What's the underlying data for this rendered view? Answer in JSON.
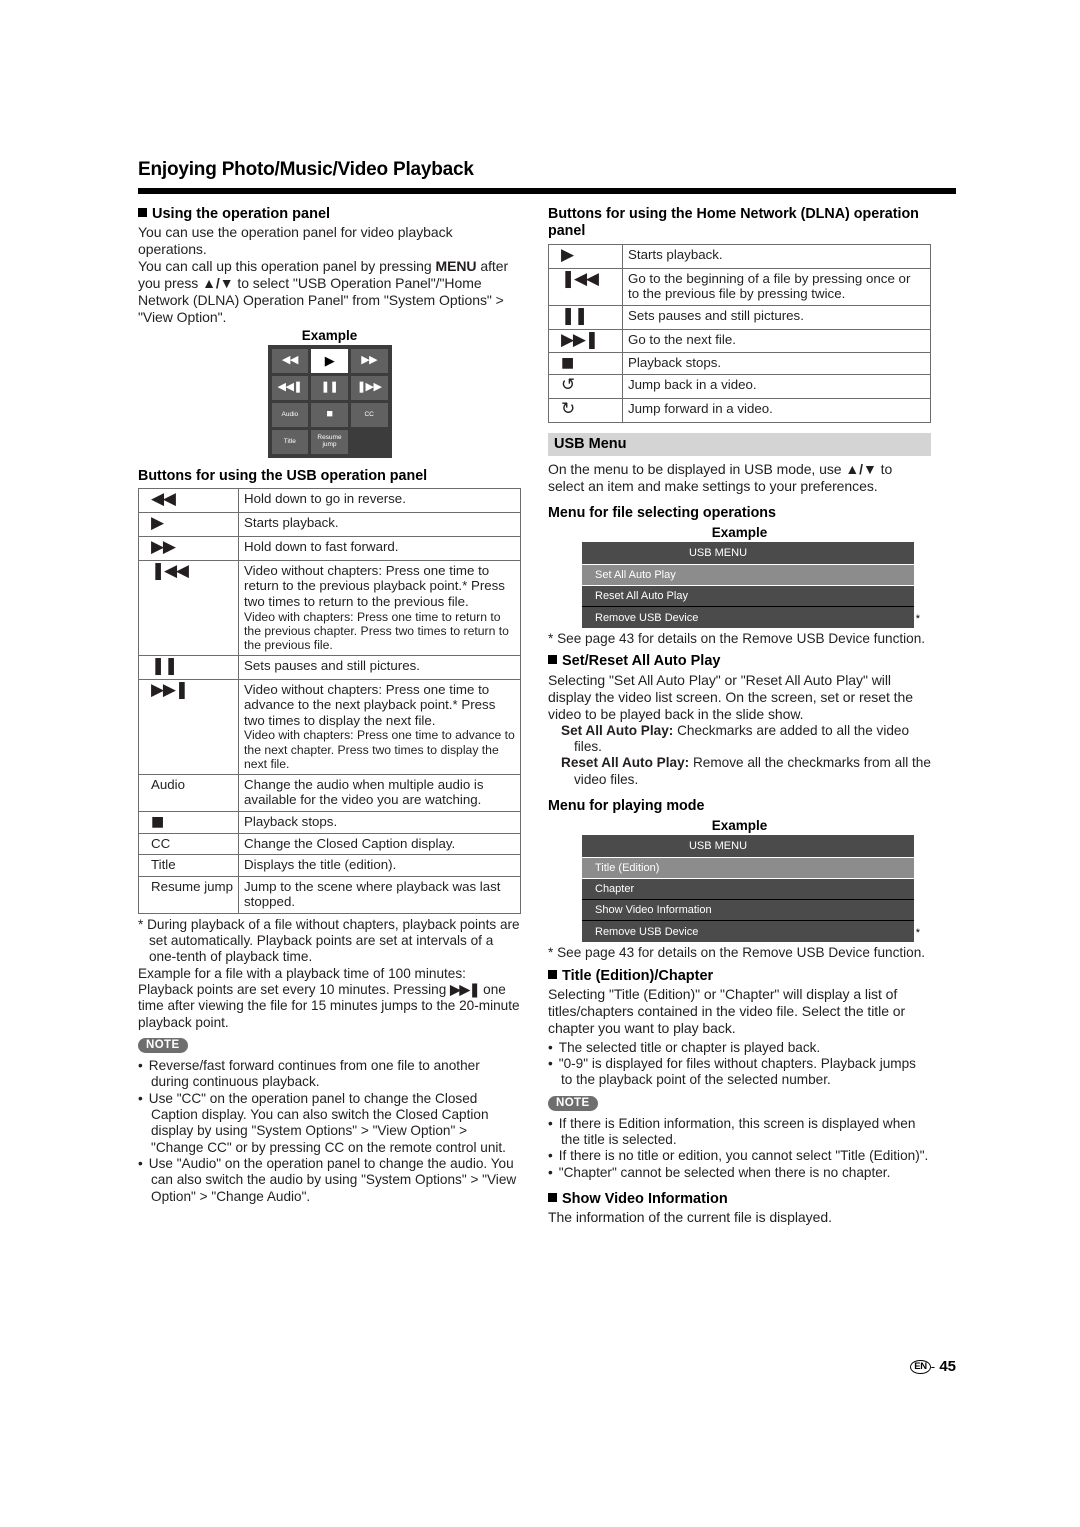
{
  "page": {
    "title": "Enjoying Photo/Music/Video Playback",
    "footer_lang": "EN",
    "footer_dash": "-",
    "footer_page": "45"
  },
  "left": {
    "using_panel": {
      "heading": "Using the operation panel",
      "para1": "You can use the operation panel for video playback operations.",
      "para2_a": "You can call up this operation panel by pressing ",
      "para2_menu": "MENU",
      "para2_b": " after you press ",
      "para2_arrows": "▲/▼",
      "para2_c": " to select \"USB Operation Panel\"/\"Home Network (DLNA) Operation Panel\" from \"System Options\" > \"View Option\".",
      "example_label": "Example"
    },
    "operation_panel": {
      "buttons": [
        {
          "name": "rewind",
          "glyph": "◀◀",
          "type": "glyph"
        },
        {
          "name": "play",
          "glyph": "▶",
          "type": "glyph",
          "highlight": true
        },
        {
          "name": "fast-forward",
          "glyph": "▶▶",
          "type": "glyph"
        },
        {
          "name": "previous",
          "glyph": "◀◀❚",
          "type": "glyph"
        },
        {
          "name": "pause",
          "glyph": "❚❚",
          "type": "glyph"
        },
        {
          "name": "next",
          "glyph": "❚▶▶",
          "type": "glyph"
        },
        {
          "name": "audio",
          "glyph": "Audio",
          "type": "text"
        },
        {
          "name": "stop",
          "glyph": "■",
          "type": "glyph"
        },
        {
          "name": "cc",
          "glyph": "CC",
          "type": "text"
        },
        {
          "name": "title",
          "glyph": "Title",
          "type": "text"
        },
        {
          "name": "resume-jump",
          "glyph": "Resume jump",
          "type": "text"
        },
        {
          "name": "blank",
          "glyph": "",
          "type": "empty"
        }
      ]
    },
    "usb_table": {
      "heading": "Buttons for using the USB operation panel",
      "rows": [
        {
          "icon": "◀◀",
          "icon_name": "rewind-icon",
          "desc": "Hold down to go in reverse."
        },
        {
          "icon": "▶",
          "icon_name": "play-icon",
          "desc": "Starts playback."
        },
        {
          "icon": "▶▶",
          "icon_name": "fast-forward-icon",
          "desc": "Hold down to fast forward."
        },
        {
          "icon": "❚◀◀",
          "icon_name": "previous-icon",
          "desc": "Video without chapters: Press one time to return to the previous playback point.* Press two times to return to the previous file.",
          "desc2": "Video with chapters: Press one time to return to the previous chapter. Press two times to return to the previous file."
        },
        {
          "icon": "❚❚",
          "icon_name": "pause-icon",
          "desc": "Sets pauses and still pictures."
        },
        {
          "icon": "▶▶❚",
          "icon_name": "next-icon",
          "desc": "Video without chapters: Press one time to advance to the next playback point.* Press two times to display the next file.",
          "desc2": "Video with chapters: Press one time to advance to the next chapter. Press two times to display the next file."
        },
        {
          "icon": "Audio",
          "icon_name": "audio-label",
          "desc": "Change the audio when multiple audio is available for the video you are watching."
        },
        {
          "icon": "■",
          "icon_name": "stop-icon",
          "desc": "Playback stops."
        },
        {
          "icon": "CC",
          "icon_name": "cc-label",
          "desc": "Change the Closed Caption display."
        },
        {
          "icon": "Title",
          "icon_name": "title-label",
          "desc": "Displays the title (edition)."
        },
        {
          "icon": "Resume jump",
          "icon_name": "resume-jump-label",
          "desc": "Jump to the scene where playback was last stopped."
        }
      ]
    },
    "footnote": {
      "star_line": "* During playback of a file without chapters, playback points are set automatically. Playback points are set at intervals of a one-tenth of playback time.",
      "example_a": "Example for a file with a playback time of 100 minutes: Playback points are set every 10 minutes. Pressing ",
      "example_icon": "▶▶❚",
      "example_b": " one time after viewing the file for 15 minutes jumps to the 20-minute playback point."
    },
    "note": {
      "badge": "NOTE",
      "items": [
        "Reverse/fast forward continues from one file to another during continuous playback.",
        "Use \"CC\" on the operation panel to change the Closed Caption display. You can also switch the Closed Caption display by using \"System Options\" > \"View Option\" > \"Change CC\" or by pressing CC on the remote control unit.",
        "Use \"Audio\" on the operation panel to change the audio. You can also switch the audio by using \"System Options\" > \"View Option\" > \"Change Audio\"."
      ]
    }
  },
  "right": {
    "dlna_table": {
      "heading": "Buttons for using the Home Network (DLNA) operation panel",
      "rows": [
        {
          "icon": "▶",
          "icon_name": "play-icon",
          "desc": "Starts playback."
        },
        {
          "icon": "❚◀◀",
          "icon_name": "previous-icon",
          "desc": "Go to the beginning of a file by pressing once or to the previous file by pressing twice."
        },
        {
          "icon": "❚❚",
          "icon_name": "pause-icon",
          "desc": "Sets pauses and still pictures."
        },
        {
          "icon": "▶▶❚",
          "icon_name": "next-icon",
          "desc": "Go to the next file."
        },
        {
          "icon": "■",
          "icon_name": "stop-icon",
          "desc": "Playback stops."
        },
        {
          "icon": "↺",
          "icon_name": "jump-back-icon",
          "desc": "Jump back in a video."
        },
        {
          "icon": "↻",
          "icon_name": "jump-forward-icon",
          "desc": "Jump forward in a video."
        }
      ]
    },
    "usb_menu_band": "USB Menu",
    "usb_menu_intro_a": "On the menu to be displayed in USB mode, use ",
    "usb_menu_intro_arrows": "▲/▼",
    "usb_menu_intro_b": " to select an item and make settings to your preferences.",
    "file_select": {
      "heading": "Menu for file selecting operations",
      "example_label": "Example",
      "menu_title": "USB MENU",
      "items": [
        {
          "label": "Set All Auto Play",
          "selected": true,
          "star": false
        },
        {
          "label": "Reset All Auto Play",
          "selected": false,
          "star": false
        },
        {
          "label": "Remove USB Device",
          "selected": false,
          "star": true
        }
      ],
      "footnote": "* See page 43 for details on the Remove USB Device function."
    },
    "set_reset": {
      "heading": "Set/Reset All Auto Play",
      "para": "Selecting \"Set All Auto Play\" or \"Reset All Auto Play\" will display the video list screen. On the screen, set or reset the video to be played back in the slide show.",
      "def1_term": "Set All Auto Play:",
      "def1_text": " Checkmarks are added to all the video files.",
      "def2_term": "Reset All Auto Play:",
      "def2_text": " Remove all the checkmarks from all the video files."
    },
    "playing_mode": {
      "heading": "Menu for playing mode",
      "example_label": "Example",
      "menu_title": "USB MENU",
      "items": [
        {
          "label": "Title (Edition)",
          "selected": true,
          "star": false
        },
        {
          "label": "Chapter",
          "selected": false,
          "star": false
        },
        {
          "label": "Show Video Information",
          "selected": false,
          "star": false
        },
        {
          "label": "Remove USB Device",
          "selected": false,
          "star": true
        }
      ],
      "footnote": "* See page 43 for details on the Remove USB Device function."
    },
    "title_chapter": {
      "heading": "Title (Edition)/Chapter",
      "para": "Selecting \"Title (Edition)\" or \"Chapter\" will display a list of titles/chapters contained in the video file. Select the title or chapter you want to play back.",
      "bullets": [
        "The selected title or chapter is played back.",
        "\"0-9\" is displayed for files without chapters. Playback jumps to the playback point of the selected number."
      ]
    },
    "note": {
      "badge": "NOTE",
      "items": [
        "If there is Edition information, this screen is displayed when the title is selected.",
        "If there is no title or edition, you cannot select \"Title (Edition)\".",
        "\"Chapter\" cannot be selected when there is no chapter."
      ]
    },
    "show_video_info": {
      "heading": "Show Video Information",
      "para": "The information of the current file is displayed."
    }
  }
}
